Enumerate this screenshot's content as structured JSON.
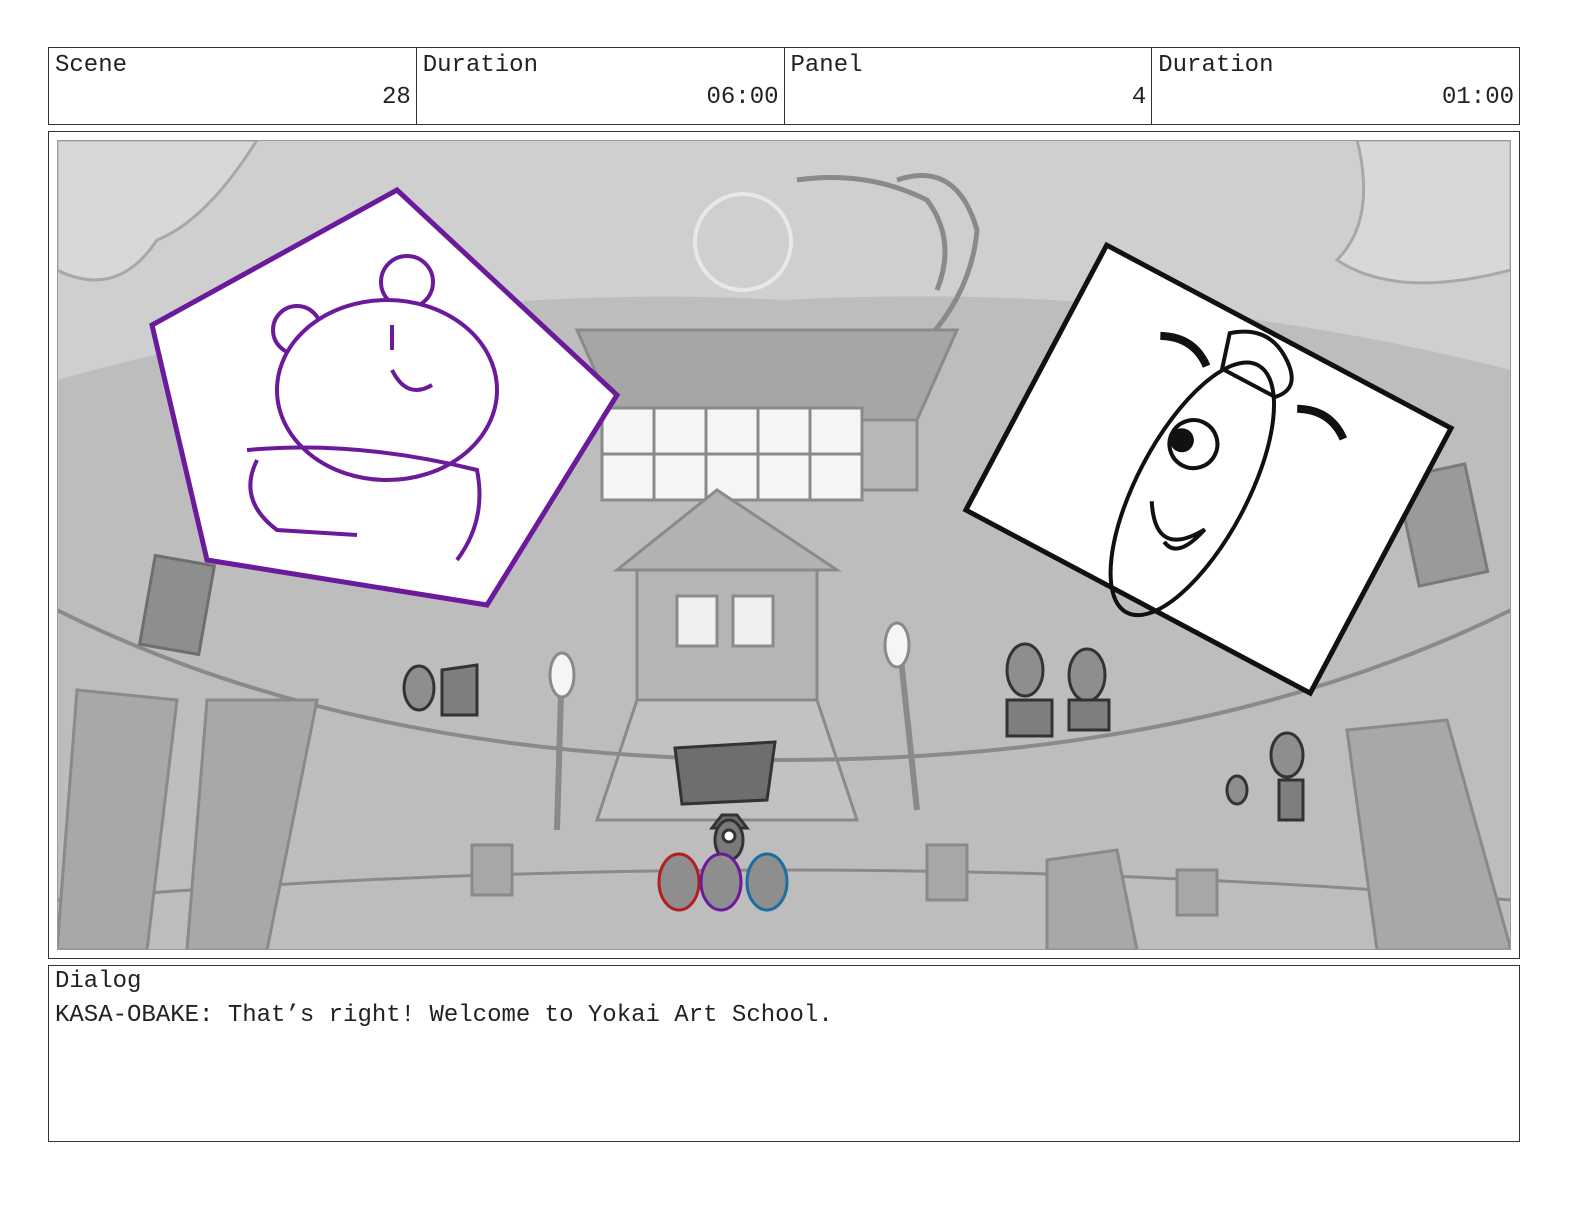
{
  "header": {
    "scene_label": "Scene",
    "scene_value": "28",
    "scene_duration_label": "Duration",
    "scene_duration_value": "06:00",
    "panel_label": "Panel",
    "panel_value": "4",
    "panel_duration_label": "Duration",
    "panel_duration_value": "01:00"
  },
  "dialog": {
    "label": "Dialog",
    "text": "KASA-OBAKE: That’s right! Welcome to Yokai Art School."
  },
  "colors": {
    "sketch_gray": "#9a9a9a",
    "dark_gray": "#6e6e6e",
    "bear_purple": "#6a1a9a",
    "red_character": "#b02020",
    "blue_character": "#1a6ea0"
  }
}
